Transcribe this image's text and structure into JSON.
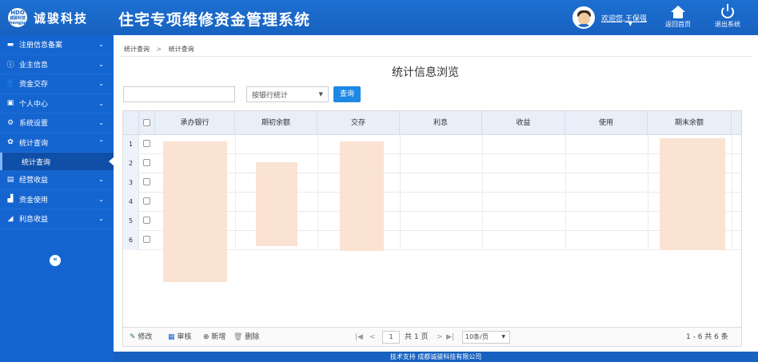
{
  "header": {
    "logo_top": "HDO",
    "logo_small": "诚骏科技",
    "logo_sub": "chengjun",
    "logo_name": "诚骏科技",
    "app_title": "住宅专项维修资金管理系统",
    "welcome": "欢迎您,王保强",
    "home_label": "返回首页",
    "exit_label": "退出系统"
  },
  "sidebar": {
    "items": [
      {
        "label": "注册信息备案",
        "icon": "card-icon",
        "glyph": "▬",
        "arrow": "⌄"
      },
      {
        "label": "业主信息",
        "icon": "info-icon",
        "glyph": "ⓘ",
        "arrow": "⌄"
      },
      {
        "label": "资金交存",
        "icon": "user-icon",
        "glyph": "👤",
        "arrow": "⌄"
      },
      {
        "label": "个人中心",
        "icon": "square-icon",
        "glyph": "▣",
        "arrow": "⌄"
      },
      {
        "label": "系统设置",
        "icon": "settings-icon",
        "glyph": "⚙",
        "arrow": "⌄"
      },
      {
        "label": "统计查询",
        "icon": "gear-icon",
        "glyph": "✿",
        "arrow": "⌃"
      },
      {
        "label": "经营收益",
        "icon": "database-icon",
        "glyph": "▤",
        "arrow": "⌄"
      },
      {
        "label": "资金使用",
        "icon": "bar-chart-icon",
        "glyph": "▟",
        "arrow": "⌄"
      },
      {
        "label": "利息收益",
        "icon": "area-chart-icon",
        "glyph": "◢",
        "arrow": "⌄"
      }
    ],
    "sub_item": "统计查询",
    "collapse": "«"
  },
  "breadcrumb": {
    "first": "统计查询",
    "sep": ">",
    "second": "统计查询"
  },
  "page_title": "统计信息浏览",
  "search": {
    "value": "",
    "select_value": "按银行统计",
    "select_arrow": "▼",
    "query_label": "查询"
  },
  "table": {
    "columns": [
      "承办银行",
      "期初余额",
      "交存",
      "利息",
      "收益",
      "使用",
      "期末余额"
    ],
    "row_numbers": [
      "1",
      "2",
      "3",
      "4",
      "5",
      "6"
    ]
  },
  "footer": {
    "edit": "修改",
    "audit": "审核",
    "add": "新增",
    "delete": "删除",
    "first": "|◀",
    "prev": "<",
    "page": "1",
    "total_pages": "共 1 页",
    "next": ">",
    "last": "▶|",
    "page_size": "10条/页",
    "range": "1 - 6   共 6 条"
  },
  "tech_support": "技术支持 成都诚骏科技有限公司",
  "colors": {
    "primary": "#1565d0",
    "header": "#1762c0",
    "redact": "#fbe3d4",
    "button": "#1e88e5"
  }
}
